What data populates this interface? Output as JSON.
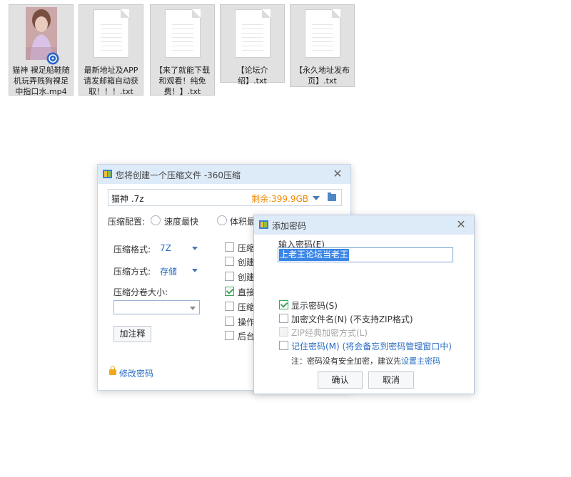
{
  "files": [
    {
      "name": "猫神 裸足船鞋随机玩弄贱狗裸足中指口水.mp4",
      "lines": [
        "猫神 裸足船鞋随",
        "机玩弄贱狗裸足",
        "中指口水.mp4"
      ],
      "type": "video"
    },
    {
      "name": "最新地址及APP请发邮箱自动获取！！！.txt",
      "lines": [
        "最新地址及APP",
        "请发邮箱自动获",
        "取！！！.txt"
      ],
      "type": "text-icon"
    },
    {
      "name": "【来了就能下载和观看！纯免费！】.txt",
      "lines": [
        "【来了就能下载",
        "和观看！纯免",
        "费！】.txt"
      ],
      "type": "text-icon"
    },
    {
      "name": "【论坛介绍】.txt",
      "lines": [
        "【论坛介绍】.txt"
      ],
      "type": "text-icon"
    },
    {
      "name": "【永久地址发布页】.txt",
      "lines": [
        "【永久地址发布",
        "页】.txt"
      ],
      "type": "text-icon"
    }
  ],
  "compress_dialog": {
    "title": "您将创建一个压缩文件 -360压缩",
    "filename": "猫神 .7z",
    "free_space": "剩余:399.9GB",
    "config_label": "压缩配置:",
    "radio_fast": "速度最快",
    "radio_small": "体积最",
    "format_label": "压缩格式:",
    "format_value": "7Z",
    "method_label": "压缩方式:",
    "method_value": "存储",
    "split_label": "压缩分卷大小:",
    "split_value": "",
    "comment_button": "加注释",
    "change_password": "修改密码",
    "options": [
      {
        "label": "压缩",
        "checked": false
      },
      {
        "label": "创建",
        "checked": false
      },
      {
        "label": "创建",
        "checked": false
      },
      {
        "label": "直接",
        "checked": true
      },
      {
        "label": "压缩",
        "checked": false
      },
      {
        "label": "操作",
        "checked": false
      },
      {
        "label": "后台",
        "checked": false
      }
    ]
  },
  "password_dialog": {
    "title": "添加密码",
    "input_label": "输入密码(E)",
    "password_value": "上老王论坛当老王",
    "show_password": "显示密码(S)",
    "encrypt_names": "加密文件名(N) (不支持ZIP格式)",
    "zip_classic": "ZIP经典加密方式(L)",
    "remember_password": "记住密码(M) (将会备忘到密码管理窗口中)",
    "note_prefix": "注：密码没有安全加密，建议先",
    "note_link": "设置主密码",
    "ok_button": "确认",
    "cancel_button": "取消"
  },
  "colors": {
    "accent": "#2b6cc4",
    "free_space": "#f08a00",
    "titlebar": "#ddeaf8",
    "check": "#3aa757"
  }
}
